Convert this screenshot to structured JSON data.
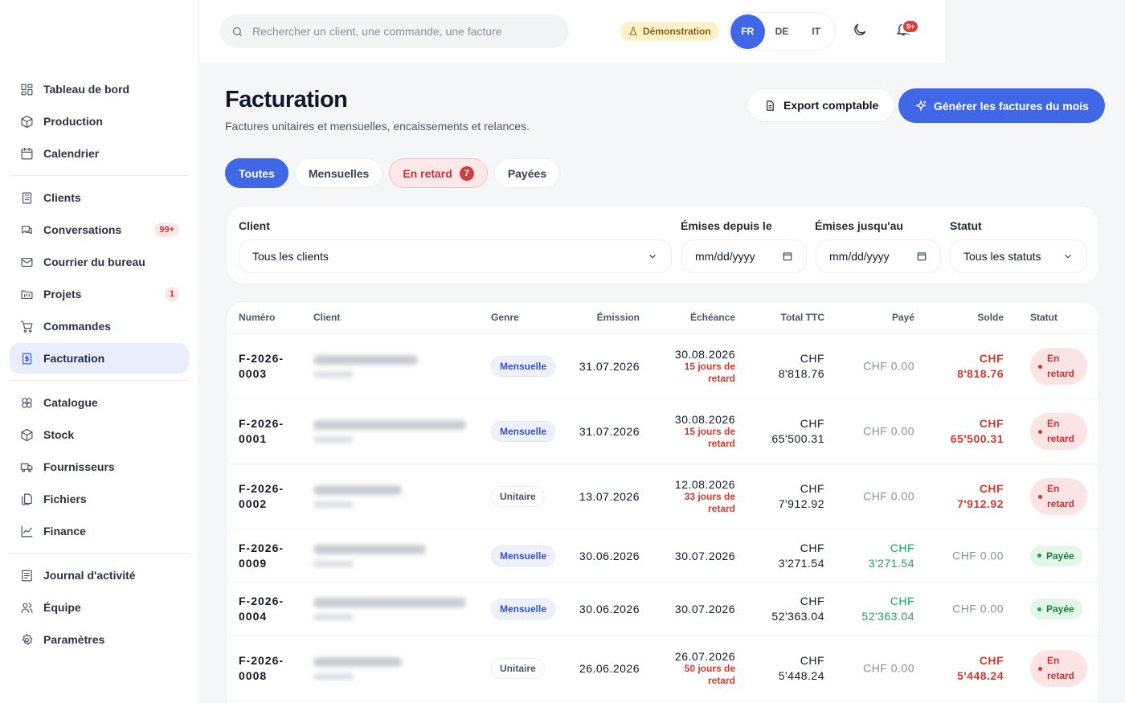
{
  "sidebar": {
    "items": [
      {
        "label": "Tableau de bord",
        "icon": "dashboard-icon"
      },
      {
        "label": "Production",
        "icon": "package-icon"
      },
      {
        "label": "Calendrier",
        "icon": "calendar-icon"
      },
      {
        "label": "Clients",
        "icon": "building-icon"
      },
      {
        "label": "Conversations",
        "icon": "chat-icon",
        "badge": "99+"
      },
      {
        "label": "Courrier du bureau",
        "icon": "mail-icon"
      },
      {
        "label": "Projets",
        "icon": "folder-kanban-icon",
        "badge": "1"
      },
      {
        "label": "Commandes",
        "icon": "cart-icon"
      },
      {
        "label": "Facturation",
        "icon": "invoice-icon"
      },
      {
        "label": "Catalogue",
        "icon": "catalog-icon"
      },
      {
        "label": "Stock",
        "icon": "box-icon"
      },
      {
        "label": "Fournisseurs",
        "icon": "truck-icon"
      },
      {
        "label": "Fichiers",
        "icon": "files-icon"
      },
      {
        "label": "Finance",
        "icon": "chart-line-icon"
      },
      {
        "label": "Journal d'activité",
        "icon": "journal-icon"
      },
      {
        "label": "Équipe",
        "icon": "team-icon"
      },
      {
        "label": "Paramètres",
        "icon": "gear-icon"
      }
    ]
  },
  "topbar": {
    "search_placeholder": "Rechercher un client, une commande, une facture",
    "demo_label": "Démonstration",
    "languages": [
      "FR",
      "DE",
      "IT"
    ],
    "active_language": "FR",
    "notifications_badge": "9+"
  },
  "page": {
    "title": "Facturation",
    "subtitle": "Factures unitaires et mensuelles, encaissements et relances.",
    "export_label": "Export comptable",
    "generate_label": "Générer les factures du mois"
  },
  "tabs": [
    {
      "label": "Toutes",
      "active": true
    },
    {
      "label": "Mensuelles"
    },
    {
      "label": "En retard",
      "count": "7"
    },
    {
      "label": "Payées"
    }
  ],
  "filters": {
    "client_label": "Client",
    "client_value": "Tous les clients",
    "from_label": "Émises depuis le",
    "from_value": "mm/dd/yyyy",
    "to_label": "Émises jusqu'au",
    "to_value": "mm/dd/yyyy",
    "status_label": "Statut",
    "status_value": "Tous les statuts"
  },
  "table": {
    "columns": [
      "Numéro",
      "Client",
      "Genre",
      "Émission",
      "Échéance",
      "Total TTC",
      "Payé",
      "Solde",
      "Statut"
    ],
    "rows": [
      {
        "num1": "F-2026-",
        "num2": "0003",
        "genre": "Mensuelle",
        "emission": "31.07.2026",
        "echeance": "30.08.2026",
        "late1": "15 jours de",
        "late2": "retard",
        "total1": "CHF",
        "total2": "8'818.76",
        "paid1": "CHF 0.00",
        "paid2": "",
        "solde1": "CHF",
        "solde2": "8'818.76",
        "status1": "En",
        "status2": "retard"
      },
      {
        "num1": "F-2026-",
        "num2": "0001",
        "genre": "Mensuelle",
        "emission": "31.07.2026",
        "echeance": "30.08.2026",
        "late1": "15 jours de",
        "late2": "retard",
        "total1": "CHF",
        "total2": "65'500.31",
        "paid1": "CHF 0.00",
        "paid2": "",
        "solde1": "CHF",
        "solde2": "65'500.31",
        "status1": "En",
        "status2": "retard"
      },
      {
        "num1": "F-2026-",
        "num2": "0002",
        "genre": "Unitaire",
        "emission": "13.07.2026",
        "echeance": "12.08.2026",
        "late1": "33 jours de",
        "late2": "retard",
        "total1": "CHF",
        "total2": "7'912.92",
        "paid1": "CHF 0.00",
        "paid2": "",
        "solde1": "CHF",
        "solde2": "7'912.92",
        "status1": "En",
        "status2": "retard"
      },
      {
        "num1": "F-2026-",
        "num2": "0009",
        "genre": "Mensuelle",
        "emission": "30.06.2026",
        "echeance": "30.07.2026",
        "late1": "",
        "late2": "",
        "total1": "CHF",
        "total2": "3'271.54",
        "paid1": "CHF",
        "paid2": "3'271.54",
        "solde1": "CHF 0.00",
        "solde2": "",
        "status1": "Payée",
        "status2": ""
      },
      {
        "num1": "F-2026-",
        "num2": "0004",
        "genre": "Mensuelle",
        "emission": "30.06.2026",
        "echeance": "30.07.2026",
        "late1": "",
        "late2": "",
        "total1": "CHF",
        "total2": "52'363.04",
        "paid1": "CHF",
        "paid2": "52'363.04",
        "solde1": "CHF 0.00",
        "solde2": "",
        "status1": "Payée",
        "status2": ""
      },
      {
        "num1": "F-2026-",
        "num2": "0008",
        "genre": "Unitaire",
        "emission": "26.06.2026",
        "echeance": "26.07.2026",
        "late1": "50 jours de",
        "late2": "retard",
        "total1": "CHF",
        "total2": "5'448.24",
        "paid1": "CHF 0.00",
        "paid2": "",
        "solde1": "CHF",
        "solde2": "5'448.24",
        "status1": "En",
        "status2": "retard"
      }
    ]
  }
}
